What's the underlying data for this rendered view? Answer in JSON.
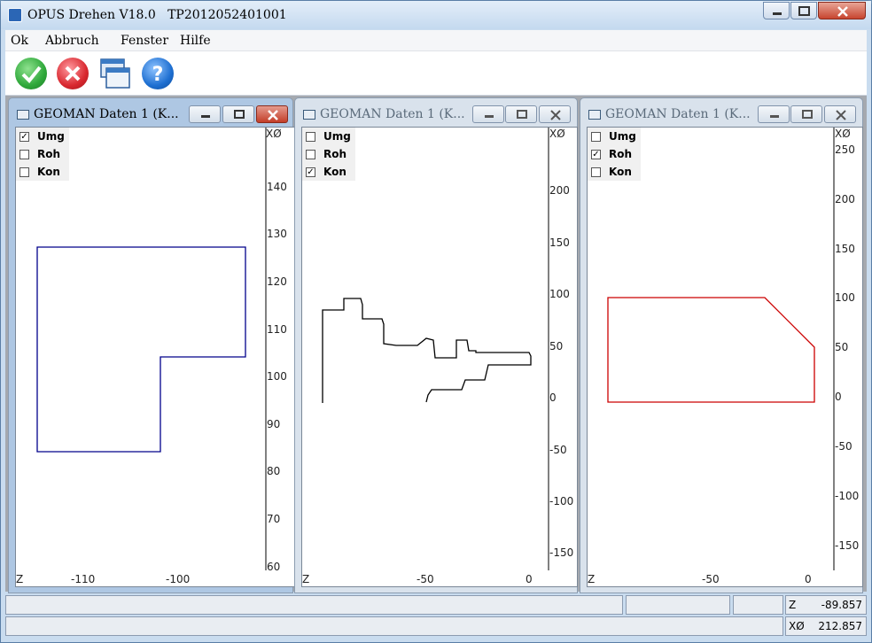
{
  "app": {
    "title": "OPUS Drehen V18.0   TP2012052401001"
  },
  "menu": {
    "items": [
      "Ok",
      "Abbruch",
      "Fenster",
      "Hilfe"
    ]
  },
  "toolbar": {
    "buttons": [
      {
        "name": "ok",
        "icon": "check-icon",
        "color": "#2fa83a"
      },
      {
        "name": "cancel",
        "icon": "x-icon",
        "color": "#d9282f"
      },
      {
        "name": "windows",
        "icon": "windows-icon",
        "color": "#3b7bc4"
      },
      {
        "name": "help",
        "icon": "question-icon",
        "color": "#1e6fd1"
      }
    ]
  },
  "children": [
    {
      "title": "GEOMAN Daten 1 (K...",
      "checkboxes": [
        {
          "label": "Umg",
          "checked": true
        },
        {
          "label": "Roh",
          "checked": false
        },
        {
          "label": "Kon",
          "checked": false
        }
      ],
      "y_label": "XØ",
      "x_label": "Z",
      "y_ticks": [
        "140",
        "130",
        "120",
        "110",
        "100",
        "90",
        "80",
        "70",
        "60"
      ],
      "x_ticks": [
        "-110",
        "-100"
      ],
      "line_color": "#00008b"
    },
    {
      "title": "GEOMAN Daten 1 (K...",
      "checkboxes": [
        {
          "label": "Umg",
          "checked": false
        },
        {
          "label": "Roh",
          "checked": false
        },
        {
          "label": "Kon",
          "checked": true
        }
      ],
      "y_label": "XØ",
      "x_label": "Z",
      "y_ticks": [
        "200",
        "150",
        "100",
        "50",
        "0",
        "-50",
        "-100",
        "-150"
      ],
      "x_ticks": [
        "-50",
        "0"
      ],
      "line_color": "#000000"
    },
    {
      "title": "GEOMAN Daten 1 (K...",
      "checkboxes": [
        {
          "label": "Umg",
          "checked": false
        },
        {
          "label": "Roh",
          "checked": true
        },
        {
          "label": "Kon",
          "checked": false
        }
      ],
      "y_label": "XØ",
      "x_label": "Z",
      "y_ticks": [
        "250",
        "200",
        "150",
        "100",
        "50",
        "0",
        "-50",
        "-100",
        "-150"
      ],
      "x_ticks": [
        "-50",
        "0"
      ],
      "line_color": "#cc0000"
    }
  ],
  "status": {
    "z_label": "Z",
    "z_value": "-89.857",
    "x_label": "XØ",
    "x_value": "212.857"
  }
}
